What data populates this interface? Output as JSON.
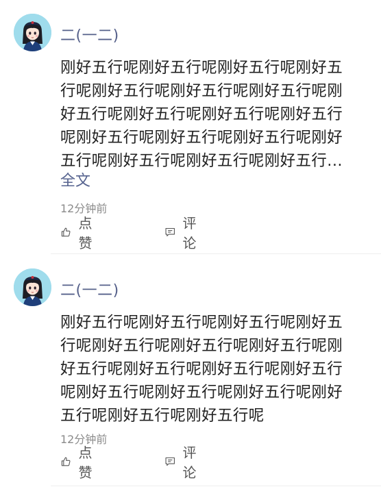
{
  "comments": [
    {
      "username": "二(一二)",
      "content": "刚好五行呢刚好五行呢刚好五行呢刚好五行呢刚好五行呢刚好五行呢刚好五行呢刚好五行呢刚好五行呢刚好五行呢刚好五行呢刚好五行呢刚好五行呢刚好五行呢刚好五行呢刚好五行呢刚好五行呢刚好五行...",
      "expand_label": "全文",
      "timestamp": "12分钟前",
      "like_label": "点赞",
      "reply_label": "评论"
    },
    {
      "username": "二(一二)",
      "content": "刚好五行呢刚好五行呢刚好五行呢刚好五行呢刚好五行呢刚好五行呢刚好五行呢刚好五行呢刚好五行呢刚好五行呢刚好五行呢刚好五行呢刚好五行呢刚好五行呢刚好五行呢刚好五行呢刚好五行呢",
      "timestamp": "12分钟前",
      "like_label": "点赞",
      "reply_label": "评论"
    }
  ],
  "colors": {
    "username": "#55608a",
    "link": "#56638f",
    "text": "#222222",
    "meta": "#8b8b8b",
    "avatar_bg": "#9fdcec"
  },
  "icons": {
    "like": "thumbs-up-icon",
    "reply": "comment-icon"
  }
}
